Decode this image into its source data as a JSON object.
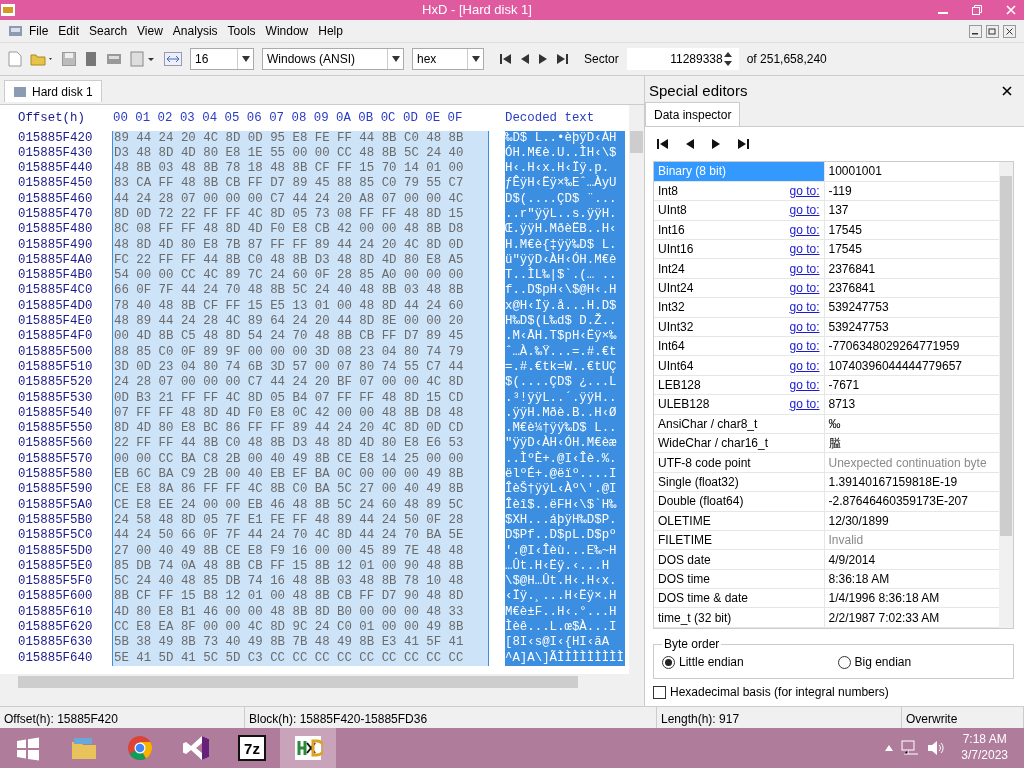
{
  "window": {
    "title": "HxD - [Hard disk 1]"
  },
  "menu": [
    "File",
    "Edit",
    "Search",
    "View",
    "Analysis",
    "Tools",
    "Window",
    "Help"
  ],
  "toolbar": {
    "bytes_per_row": "16",
    "charset": "Windows (ANSI)",
    "display": "hex",
    "sector_label": "Sector",
    "sector": "11289338",
    "sector_total": "of 251,658,240"
  },
  "document_tabs": [
    {
      "label": "Hard disk 1",
      "selected": true
    }
  ],
  "hex_view": {
    "offset_header": "Offset(h)",
    "columns": [
      "00",
      "01",
      "02",
      "03",
      "04",
      "05",
      "06",
      "07",
      "08",
      "09",
      "0A",
      "0B",
      "0C",
      "0D",
      "0E",
      "0F"
    ],
    "decoded_header": "Decoded text",
    "rows": [
      {
        "offset": "015885F420",
        "bytes": "89 44 24 20 4C 8D 0D 95 E8 FE FF 44 8B C0 48 8B",
        "text": "‰D$ L..•èþÿD‹ÀH",
        "selected": true
      },
      {
        "offset": "015885F430",
        "bytes": "D3 48 8D 4D 80 E8 1E 55 00 00 CC 48 8B 5C 24 40",
        "text": "ÓH.M€è.U..ÌH‹\\$",
        "selected": true
      },
      {
        "offset": "015885F440",
        "bytes": "48 8B 03 48 8B 78 18 48 8B CF FF 15 70 14 01 00",
        "text": "H‹.H‹x.H‹Ïÿ.p.",
        "selected": true
      },
      {
        "offset": "015885F450",
        "bytes": "83 CA FF 48 8B CB FF D7 89 45 88 85 C0 79 55 C7",
        "text": "ƒÊÿH‹Ëÿ×‰Eˆ…ÀyU",
        "selected": true
      },
      {
        "offset": "015885F460",
        "bytes": "44 24 28 07 00 00 00 C7 44 24 20 A8 07 00 00 4C",
        "text": "D$(....ÇD$ ¨...",
        "selected": true
      },
      {
        "offset": "015885F470",
        "bytes": "8D 0D 72 22 FF FF 4C 8D 05 73 08 FF FF 48 8D 15",
        "text": "..r\"ÿÿL..s.ÿÿH.",
        "selected": true
      },
      {
        "offset": "015885F480",
        "bytes": "8C 08 FF FF 48 8D 4D F0 E8 CB 42 00 00 48 8B D8",
        "text": "Œ.ÿÿH.MðèËB..H‹",
        "selected": true
      },
      {
        "offset": "015885F490",
        "bytes": "48 8D 4D 80 E8 7B 87 FF FF 89 44 24 20 4C 8D 0D",
        "text": "H.M€è{‡ÿÿ‰D$ L.",
        "selected": true
      },
      {
        "offset": "015885F4A0",
        "bytes": "FC 22 FF FF 44 8B C0 48 8B D3 48 8D 4D 80 E8 A5",
        "text": "ü\"ÿÿD‹ÀH‹ÓH.M€è",
        "selected": true
      },
      {
        "offset": "015885F4B0",
        "bytes": "54 00 00 CC 4C 89 7C 24 60 0F 28 85 A0 00 00 00",
        "text": "T..ÌL‰|$`.(… ..",
        "selected": true
      },
      {
        "offset": "015885F4C0",
        "bytes": "66 0F 7F 44 24 70 48 8B 5C 24 40 48 8B 03 48 8B",
        "text": "f..D$pH‹\\$@H‹.H",
        "selected": true
      },
      {
        "offset": "015885F4D0",
        "bytes": "78 40 48 8B CF FF 15 E5 13 01 00 48 8D 44 24 60",
        "text": "x@H‹Ïÿ.å...H.D$",
        "selected": true
      },
      {
        "offset": "015885F4E0",
        "bytes": "48 89 44 24 28 4C 89 64 24 20 44 8D 8E 00 00 20",
        "text": "H‰D$(L‰d$ D.Ž..",
        "selected": true
      },
      {
        "offset": "015885F4F0",
        "bytes": "00 4D 8B C5 48 8D 54 24 70 48 8B CB FF D7 89 45",
        "text": ".M‹ÅH.T$pH‹Ëÿ×‰",
        "selected": true
      },
      {
        "offset": "015885F500",
        "bytes": "88 85 C0 0F 89 9F 00 00 00 3D 08 23 04 80 74 79",
        "text": "ˆ…À.‰Ÿ...=.#.€t",
        "selected": true
      },
      {
        "offset": "015885F510",
        "bytes": "3D 0D 23 04 80 74 6B 3D 57 00 07 80 74 55 C7 44",
        "text": "=.#.€tk=W..€tUÇ",
        "selected": true
      },
      {
        "offset": "015885F520",
        "bytes": "24 28 07 00 00 00 C7 44 24 20 BF 07 00 00 4C 8D",
        "text": "$(....ÇD$ ¿...L",
        "selected": true
      },
      {
        "offset": "015885F530",
        "bytes": "0D B3 21 FF FF 4C 8D 05 B4 07 FF FF 48 8D 15 CD",
        "text": ".³!ÿÿL..´.ÿÿH..",
        "selected": true
      },
      {
        "offset": "015885F540",
        "bytes": "07 FF FF 48 8D 4D F0 E8 0C 42 00 00 48 8B D8 48",
        "text": ".ÿÿH.Mðè.B..H‹Ø",
        "selected": true
      },
      {
        "offset": "015885F550",
        "bytes": "8D 4D 80 E8 BC 86 FF FF 89 44 24 20 4C 8D 0D CD",
        "text": ".M€è¼†ÿÿ‰D$ L..",
        "selected": true
      },
      {
        "offset": "015885F560",
        "bytes": "22 FF FF 44 8B C0 48 8B D3 48 8D 4D 80 E8 E6 53",
        "text": "\"ÿÿD‹ÀH‹ÓH.M€èæ",
        "selected": true
      },
      {
        "offset": "015885F570",
        "bytes": "00 00 CC BA C8 2B 00 40 49 8B CE E8 14 25 00 00",
        "text": "..ÌºÈ+.@I‹Îè.%.",
        "selected": true
      },
      {
        "offset": "015885F580",
        "bytes": "EB 6C BA C9 2B 00 40 EB EF BA 0C 00 00 00 49 8B",
        "text": "ëlºÉ+.@ëïº....I",
        "selected": true
      },
      {
        "offset": "015885F590",
        "bytes": "CE E8 8A 86 FF FF 4C 8B C0 BA 5C 27 00 40 49 8B",
        "text": "ÎèŠ†ÿÿL‹Àº\\'.@I",
        "selected": true
      },
      {
        "offset": "015885F5A0",
        "bytes": "CE E8 EE 24 00 00 EB 46 48 8B 5C 24 60 48 89 5C",
        "text": "Îèî$..ëFH‹\\$`H‰",
        "selected": true
      },
      {
        "offset": "015885F5B0",
        "bytes": "24 58 48 8D 05 7F E1 FE FF 48 89 44 24 50 0F 28",
        "text": "$XH...áþÿH‰D$P.",
        "selected": true
      },
      {
        "offset": "015885F5C0",
        "bytes": "44 24 50 66 0F 7F 44 24 70 4C 8D 44 24 70 BA 5E",
        "text": "D$Pf..D$pL.D$pº",
        "selected": true
      },
      {
        "offset": "015885F5D0",
        "bytes": "27 00 40 49 8B CE E8 F9 16 00 00 45 89 7E 48 48",
        "text": "'.@I‹Îèù...E‰~H",
        "selected": true
      },
      {
        "offset": "015885F5E0",
        "bytes": "85 DB 74 0A 48 8B CB FF 15 8B 12 01 00 90 48 8B",
        "text": "…Ût.H‹Ëÿ.‹...H",
        "selected": true
      },
      {
        "offset": "015885F5F0",
        "bytes": "5C 24 40 48 85 DB 74 16 48 8B 03 48 8B 78 10 48",
        "text": "\\$@H…Ût.H‹.H‹x.",
        "selected": true
      },
      {
        "offset": "015885F600",
        "bytes": "8B CF FF 15 B8 12 01 00 48 8B CB FF D7 90 48 8D",
        "text": "‹Ïÿ.¸...H‹Ëÿ×.H",
        "selected": true
      },
      {
        "offset": "015885F610",
        "bytes": "4D 80 E8 B1 46 00 00 48 8B 8D B0 00 00 00 48 33",
        "text": "M€è±F..H‹.°...H",
        "selected": true
      },
      {
        "offset": "015885F620",
        "bytes": "CC E8 EA 8F 00 00 4C 8D 9C 24 C0 01 00 00 49 8B",
        "text": "Ìèê...L.œ$À...I",
        "selected": true
      },
      {
        "offset": "015885F630",
        "bytes": "5B 38 49 8B 73 40 49 8B 7B 48 49 8B E3 41 5F 41",
        "text": "[8I‹s@I‹{HI‹ãA",
        "selected": true
      },
      {
        "offset": "015885F640",
        "bytes": "5E 41 5D 41 5C 5D C3 CC CC CC CC CC CC CC CC CC",
        "text": "^A]A\\]ÃÌÌÌÌÌÌÌÌÌ",
        "selected": true
      }
    ]
  },
  "special_editors": {
    "title": "Special editors",
    "tabs": [
      {
        "label": "Data inspector",
        "selected": true
      }
    ],
    "inspector": [
      {
        "label": "Binary (8 bit)",
        "value": "10001001",
        "muted": false,
        "selected": true
      },
      {
        "label": "Int8",
        "link": "go to:",
        "value": "-119",
        "muted": false,
        "selected": false
      },
      {
        "label": "UInt8",
        "link": "go to:",
        "value": "137",
        "muted": false,
        "selected": false
      },
      {
        "label": "Int16",
        "link": "go to:",
        "value": "17545",
        "muted": false,
        "selected": false
      },
      {
        "label": "UInt16",
        "link": "go to:",
        "value": "17545",
        "muted": false,
        "selected": false
      },
      {
        "label": "Int24",
        "link": "go to:",
        "value": "2376841",
        "muted": false,
        "selected": false
      },
      {
        "label": "UInt24",
        "link": "go to:",
        "value": "2376841",
        "muted": false,
        "selected": false
      },
      {
        "label": "Int32",
        "link": "go to:",
        "value": "539247753",
        "muted": false,
        "selected": false
      },
      {
        "label": "UInt32",
        "link": "go to:",
        "value": "539247753",
        "muted": false,
        "selected": false
      },
      {
        "label": "Int64",
        "link": "go to:",
        "value": "-7706348029264771959",
        "muted": false,
        "selected": false
      },
      {
        "label": "UInt64",
        "link": "go to:",
        "value": "10740396044444779657",
        "muted": false,
        "selected": false
      },
      {
        "label": "LEB128",
        "link": "go to:",
        "value": "-7671",
        "muted": false,
        "selected": false
      },
      {
        "label": "ULEB128",
        "link": "go to:",
        "value": "8713",
        "muted": false,
        "selected": false
      },
      {
        "label": "AnsiChar / char8_t",
        "value": "‰",
        "muted": false,
        "selected": false
      },
      {
        "label": "WideChar / char16_t",
        "value": "膉",
        "muted": false,
        "selected": false
      },
      {
        "label": "UTF-8 code point",
        "value": "Unexpected continuation byte",
        "muted": true,
        "selected": false
      },
      {
        "label": "Single (float32)",
        "value": "1.39140167159818E-19",
        "muted": false,
        "selected": false
      },
      {
        "label": "Double (float64)",
        "value": "-2.87646460359173E-207",
        "muted": false,
        "selected": false
      },
      {
        "label": "OLETIME",
        "value": "12/30/1899",
        "muted": false,
        "selected": false
      },
      {
        "label": "FILETIME",
        "value": "Invalid",
        "muted": true,
        "selected": false
      },
      {
        "label": "DOS date",
        "value": "4/9/2014",
        "muted": false,
        "selected": false
      },
      {
        "label": "DOS time",
        "value": "8:36:18 AM",
        "muted": false,
        "selected": false
      },
      {
        "label": "DOS time & date",
        "value": "1/4/1996 8:36:18 AM",
        "muted": false,
        "selected": false
      },
      {
        "label": "time_t (32 bit)",
        "value": "2/2/1987 7:02:33 AM",
        "muted": false,
        "selected": false
      }
    ],
    "byte_order": {
      "title": "Byte order",
      "options": [
        {
          "label": "Little endian",
          "selected": true
        },
        {
          "label": "Big endian",
          "selected": false
        }
      ]
    },
    "hex_basis": {
      "label": "Hexadecimal basis (for integral numbers)",
      "checked": false
    }
  },
  "status_bar": [
    "Offset(h): 15885F420",
    "Block(h): 15885F420-15885FD36",
    "Length(h): 917",
    "Overwrite"
  ],
  "taskbar": {
    "apps": [
      {
        "kind": "start",
        "selected": false
      },
      {
        "kind": "explorer",
        "selected": false
      },
      {
        "kind": "chrome",
        "selected": false
      },
      {
        "kind": "studio",
        "selected": false
      },
      {
        "kind": "archiver",
        "label": "7z",
        "selected": false
      },
      {
        "kind": "hxd",
        "selected": true
      }
    ],
    "time": "7:18 AM",
    "date": "3/7/2023"
  }
}
